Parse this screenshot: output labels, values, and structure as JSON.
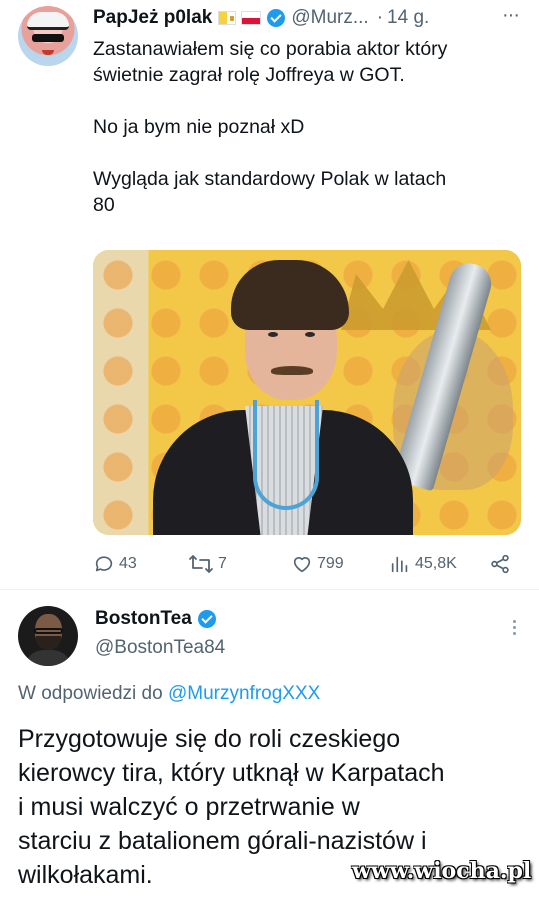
{
  "tweet": {
    "author": {
      "name": "PapJeż p0lak",
      "handle": "@Murz...",
      "time": "14 g.",
      "separator": "·"
    },
    "paragraphs": [
      "Zastanawiałem się co porabia aktor który",
      "świetnie zagrał rolę Joffreya w GOT.",
      "",
      "No ja bym nie poznał xD",
      "",
      "Wygląda jak standardowy Polak w latach",
      "80"
    ],
    "actions": {
      "replies": "43",
      "retweets": "7",
      "likes": "799",
      "views": "45,8K"
    },
    "more": "···"
  },
  "reply": {
    "author": {
      "name": "BostonTea",
      "handle": "@BostonTea84"
    },
    "replying_prefix": "W odpowiedzi do",
    "replying_to": "@MurzynfrogXXX",
    "lines": [
      "Przygotowuje się do roli czeskiego",
      "kierowcy tira, który utknął w Karpatach",
      "i musi walczyć o przetrwanie w",
      "starciu z batalionem górali-nazistów i",
      "wilkołakami."
    ]
  },
  "watermark": "www.wiocha.pl",
  "colors": {
    "text": "#0f1419",
    "secondary": "#536471",
    "link": "#1d9bf0",
    "verified": "#1d9bf0"
  },
  "icons": [
    "reply-icon",
    "retweet-icon",
    "like-icon",
    "views-icon",
    "share-icon",
    "verified-badge-icon",
    "more-icon"
  ]
}
